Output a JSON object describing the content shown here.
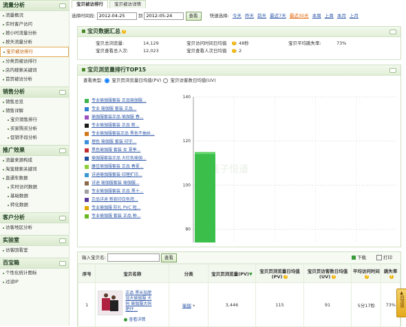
{
  "sidebar": {
    "sections": [
      {
        "title": "流量分析",
        "items": [
          {
            "label": "流量概况",
            "active": false
          },
          {
            "label": "实时客户访问",
            "active": false
          },
          {
            "label": "按小时流量分析",
            "active": false
          },
          {
            "label": "按天流量分析",
            "active": false
          },
          {
            "label": "宝贝被访排行",
            "active": true
          },
          {
            "label": "分类页被访排行",
            "active": false
          },
          {
            "label": "店内搜索关键词",
            "active": false
          },
          {
            "label": "首页被访分析",
            "active": false
          }
        ]
      },
      {
        "title": "销售分析",
        "items": [
          {
            "label": "销售总览",
            "active": false,
            "sub": false
          },
          {
            "label": "销售详解",
            "active": false,
            "sub": false
          },
          {
            "label": "宝贝销售排行",
            "active": false,
            "sub": true
          },
          {
            "label": "买家购买分析",
            "active": false,
            "sub": true
          },
          {
            "label": "促销手段分析",
            "active": false,
            "sub": true
          }
        ]
      },
      {
        "title": "推广效果",
        "items": [
          {
            "label": "流量来源构成",
            "active": false,
            "sub": false
          },
          {
            "label": "淘宝搜索关键词",
            "active": false,
            "sub": false
          },
          {
            "label": "直通车数据",
            "active": false,
            "sub": false
          },
          {
            "label": "实时访问数据",
            "active": false,
            "sub": true
          },
          {
            "label": "基础数据",
            "active": false,
            "sub": true
          },
          {
            "label": "转化数据",
            "active": false,
            "sub": true
          }
        ]
      },
      {
        "title": "客户分析",
        "items": [
          {
            "label": "访客地区分析",
            "active": false
          }
        ]
      },
      {
        "title": "实验室",
        "items": [
          {
            "label": "访客回看室",
            "active": false
          }
        ]
      },
      {
        "title": "百宝箱",
        "items": [
          {
            "label": "个性化统计图标",
            "active": false
          },
          {
            "label": "过滤IP",
            "active": false
          }
        ]
      }
    ]
  },
  "tabs": [
    "宝贝被访排行",
    "宝贝被访详情"
  ],
  "toolbar": {
    "label": "选择时间段:",
    "start_date": "2012-04-25",
    "to_label": "到",
    "end_date": "2012-05-24",
    "query_label": "查看",
    "quick_label": "快速选择:",
    "quick_links": [
      {
        "label": "今天",
        "active": false
      },
      {
        "label": "昨天",
        "active": false
      },
      {
        "label": "前天",
        "active": false
      },
      {
        "label": "最近7天",
        "active": false
      },
      {
        "label": "最近30天",
        "active": true
      },
      {
        "label": "本周",
        "active": false
      },
      {
        "label": "上周",
        "active": false
      },
      {
        "label": "本月",
        "active": false
      },
      {
        "label": "上月",
        "active": false
      }
    ]
  },
  "summary": {
    "title": "宝贝数据汇总",
    "items": [
      {
        "label": "宝贝总浏览量:",
        "value": "14,129"
      },
      {
        "label": "宝贝访问时间日均值",
        "value": "48秒"
      },
      {
        "label": "宝贝平均跳失率:",
        "value": "73%"
      },
      {
        "label": "宝贝查看总人次:",
        "value": "12,023"
      },
      {
        "label": "宝贝查看人次日均值",
        "value": "2"
      }
    ]
  },
  "top15": {
    "title": "宝贝浏览量排行TOP15",
    "view_label": "查看类型:",
    "options": [
      {
        "label": "宝贝页浏览量日均值(PV)",
        "checked": true
      },
      {
        "label": "宝贝访客数日均值(UV)",
        "checked": false
      }
    ],
    "legend": [
      {
        "label": "专业瑜伽服套装 正品瑜伽服...",
        "color": "#3cb34a"
      },
      {
        "label": "专业 瑜伽服 套装 正品...",
        "color": "#2f7fd0"
      },
      {
        "label": "瑜伽服套装正品 瑜伽服 春...",
        "color": "#9b4fc0"
      },
      {
        "label": "专业瑜伽服套装 正品 新...",
        "color": "#1a1a1a"
      },
      {
        "label": "专业瑜伽服套装正品 黑色不抽丝...",
        "color": "#d07a20"
      },
      {
        "label": "理色 瑜伽服 套装 印字...",
        "color": "#3d8fe0"
      },
      {
        "label": "黑色瑜伽服 套装 女 夏季...",
        "color": "#c03030"
      },
      {
        "label": "瑜伽服套装正品 大红色瑜伽...",
        "color": "#1f4f9f"
      },
      {
        "label": "康佳瑜伽服套装 正品 春夏...",
        "color": "#8fcf3a"
      },
      {
        "label": "详迪瑜伽服套装 印理扩印...",
        "color": "#3a9ad0"
      },
      {
        "label": "详迪 瑜伽服套装 瑜伽服...",
        "color": "#8a6a4a"
      },
      {
        "label": "专业瑜伽服套装 正品 黑十...",
        "color": "#a0a0a0"
      },
      {
        "label": "正品详迪 新款印白色拜...",
        "color": "#5a3a9a"
      },
      {
        "label": "专业瑜伽服 防扎 PVC 短...",
        "color": "#e0a800"
      },
      {
        "label": "专业瑜伽服 套装 正品 种...",
        "color": "#6ab820"
      }
    ],
    "watermark": "量子恒道"
  },
  "chart_data": {
    "type": "bar",
    "categories": [
      "专业瑜伽服套装 正品瑜伽服..."
    ],
    "values": [
      115
    ],
    "ylim": [
      74,
      140
    ],
    "yticks": [
      80,
      100,
      120,
      140
    ],
    "grid": true
  },
  "table": {
    "search_label": "输入宝贝名:",
    "search_value": "",
    "search_button": "查看",
    "download_label": "下载",
    "print_label": "打印",
    "columns": [
      "序号",
      "宝贝名称",
      "分类",
      "宝贝页浏览量(PV)",
      "宝贝页浏览量日均值(PV)",
      "宝贝页访客数日均值(UV)",
      "平均访问时间",
      "跳失率"
    ],
    "rows": [
      {
        "index": "1",
        "name_lines": [
          "正品 黑长加肥",
          "加大瑜伽服 大",
          "码 瑜伽服大码",
          "肥仔..."
        ],
        "detail_link": "查看详情",
        "category": "瑜伽",
        "pv": "3,446",
        "pv_avg": "115",
        "uv_avg": "91",
        "avg_time": "5分17秒",
        "bounce": "73%"
      }
    ]
  },
  "floater": "回顶部"
}
